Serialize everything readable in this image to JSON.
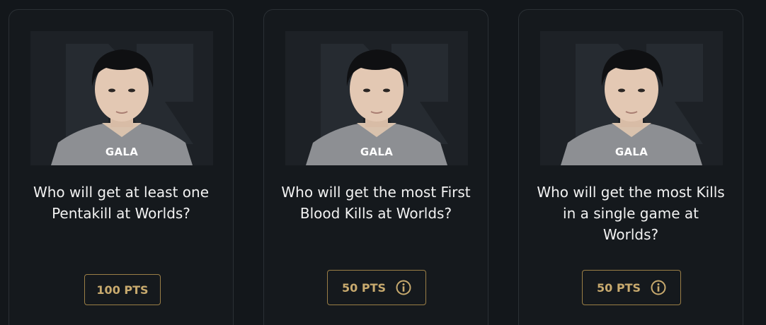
{
  "cards": [
    {
      "player": "GALA",
      "question": "Who will get at least one Pentakill at Worlds?",
      "points": "100 PTS",
      "has_info": false
    },
    {
      "player": "GALA",
      "question": "Who will get the most First Blood Kills at Worlds?",
      "points": "50 PTS",
      "has_info": true
    },
    {
      "player": "GALA",
      "question": "Who will get the most Kills in a single game at Worlds?",
      "points": "50 PTS",
      "has_info": true
    }
  ],
  "colors": {
    "background": "#13171b",
    "card_border": "#2b3035",
    "gold": "#c8aa6e",
    "text": "#f2f2f2"
  },
  "icons": {
    "team_logo": "team-logo-icon",
    "info": "info-icon"
  }
}
